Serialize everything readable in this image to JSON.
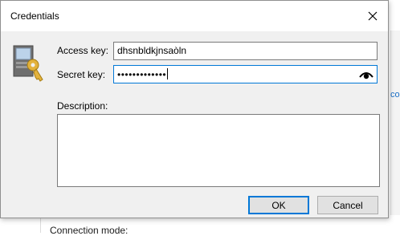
{
  "dialog": {
    "title": "Credentials",
    "close_icon": "close-icon",
    "access_key": {
      "label": "Access key:",
      "value": "dhsnbldkjnsaòln"
    },
    "secret_key": {
      "label": "Secret key:",
      "masked_value": "•••••••••••••",
      "reveal_icon": "eye-icon"
    },
    "description": {
      "label": "Description:",
      "value": ""
    },
    "buttons": {
      "ok": "OK",
      "cancel": "Cancel"
    },
    "icon": "credentials-key-icon"
  },
  "background": {
    "bottom_text": "Connection mode:",
    "right_hint": "co"
  },
  "colors": {
    "focus_border": "#0078d7",
    "dialog_bg": "#f0f0f0",
    "button_bg": "#e1e1e1"
  }
}
